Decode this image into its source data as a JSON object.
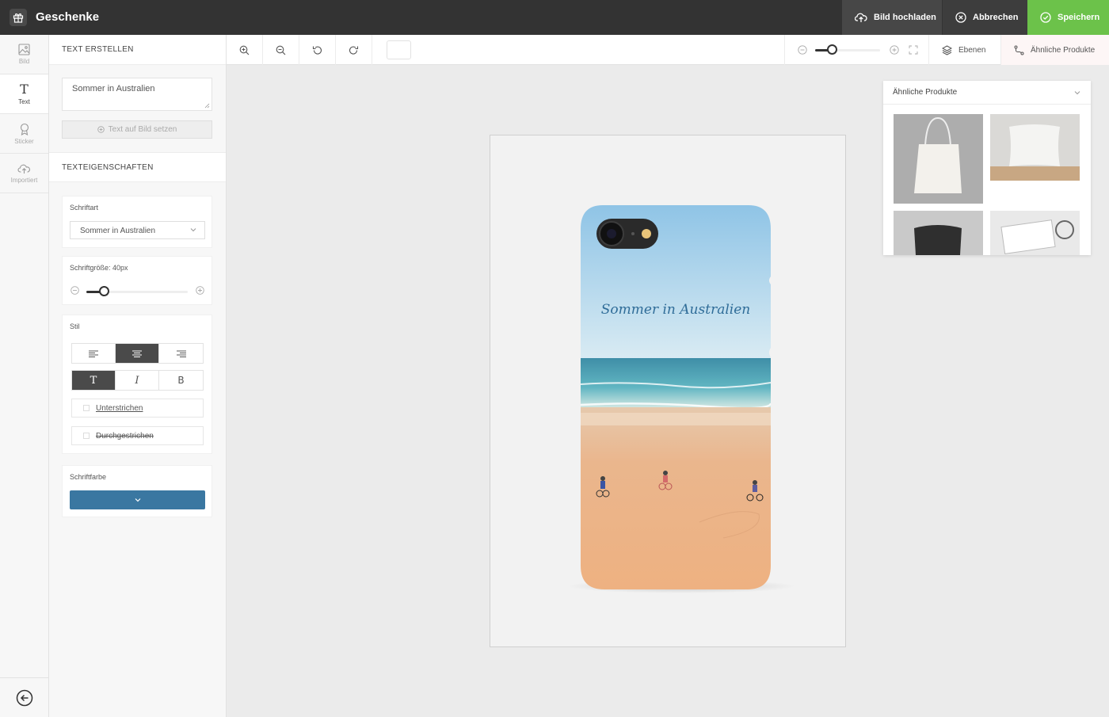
{
  "app": {
    "title": "Geschenke"
  },
  "top_actions": {
    "upload": "Bild hochladen",
    "cancel": "Abbrechen",
    "save": "Speichern"
  },
  "rail": [
    {
      "label": "Bild",
      "icon": "image-icon"
    },
    {
      "label": "Text",
      "icon": "text-icon"
    },
    {
      "label": "Sticker",
      "icon": "sticker-icon"
    },
    {
      "label": "Importiert",
      "icon": "upload-cloud-icon"
    }
  ],
  "panel": {
    "create_title": "TEXT ERSTELLEN",
    "text_value": "Sommer in Australien",
    "set_button": "Text auf Bild setzen",
    "props_title": "TEXTEIGENSCHAFTEN",
    "font_label": "Schriftart",
    "font_value": "Sommer in Australien",
    "size_label": "Schriftgröße: 40px",
    "size_level": 0.17,
    "style_label": "Stil",
    "underline_label": "Unterstrichen",
    "strike_label": "Durchgestrichen",
    "color_label": "Schriftfarbe",
    "color_value": "#3a77a1"
  },
  "toolbar": {
    "zoom_level": 0.25,
    "layers": "Ebenen",
    "similar": "Ähnliche Produkte"
  },
  "canvas": {
    "phone_text": "Sommer in Australien"
  },
  "similar": {
    "title": "Ähnliche Produkte",
    "products": [
      "tote-bag",
      "white-pillow",
      "black-pillow",
      "keychain"
    ]
  }
}
